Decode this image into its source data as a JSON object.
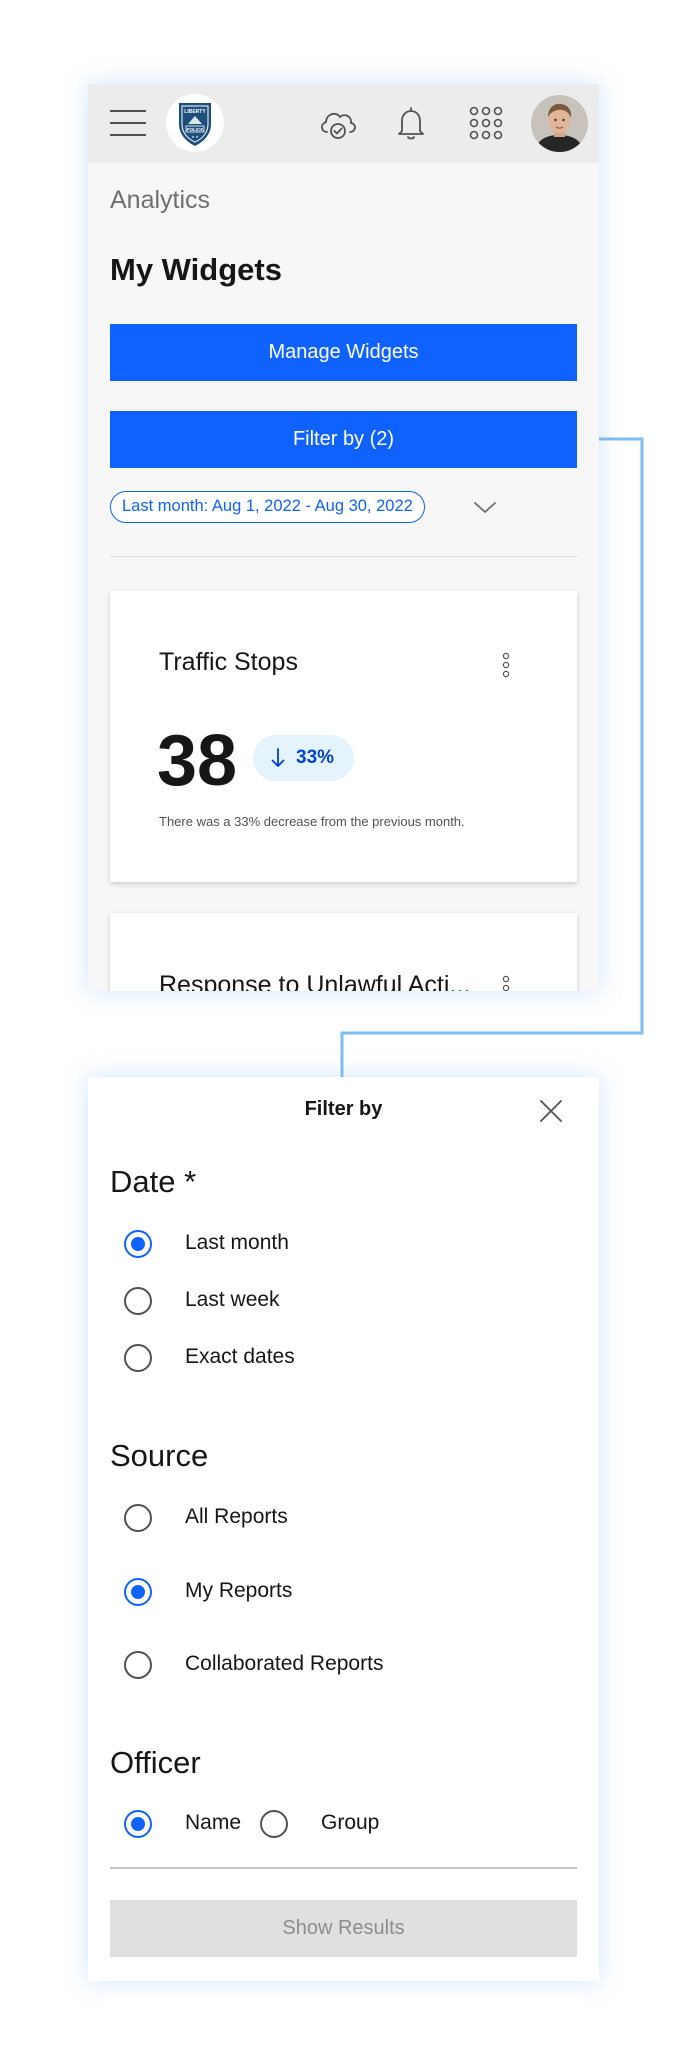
{
  "app": {
    "logo_text": "LIBERTY POLICE",
    "icons": [
      "menu-icon",
      "cloud-sync-icon",
      "notification-bell-icon",
      "app-grid-icon"
    ]
  },
  "colors": {
    "accent": "#0f62fe",
    "accent_light": "#e5f3fd",
    "connector": "#7cbdf2",
    "disabled_bg": "#e0e0e0"
  },
  "analytics": {
    "breadcrumb": "Analytics",
    "title": "My Widgets",
    "manage_button": "Manage Widgets",
    "filter_button": "Filter by (2)",
    "date_tag": "Last month: Aug 1, 2022 - Aug 30, 2022"
  },
  "widgets": [
    {
      "title": "Traffic Stops",
      "value": "38",
      "trend": "33%",
      "trend_direction": "down",
      "note": "There was a 33% decrease from the previous month."
    },
    {
      "title": "Response to Unlawful Acti..."
    }
  ],
  "filter": {
    "title": "Filter by",
    "date": {
      "title": "Date *",
      "options": [
        {
          "label": "Last month",
          "checked": true
        },
        {
          "label": "Last week",
          "checked": false
        },
        {
          "label": "Exact dates",
          "checked": false
        }
      ]
    },
    "source": {
      "title": "Source",
      "options": [
        {
          "label": "All Reports",
          "checked": false
        },
        {
          "label": "My Reports",
          "checked": true
        },
        {
          "label": "Collaborated Reports",
          "checked": false
        }
      ]
    },
    "officer": {
      "title": "Officer",
      "options": [
        {
          "label": "Name",
          "checked": true
        },
        {
          "label": "Group",
          "checked": false
        }
      ]
    },
    "submit": "Show Results"
  }
}
